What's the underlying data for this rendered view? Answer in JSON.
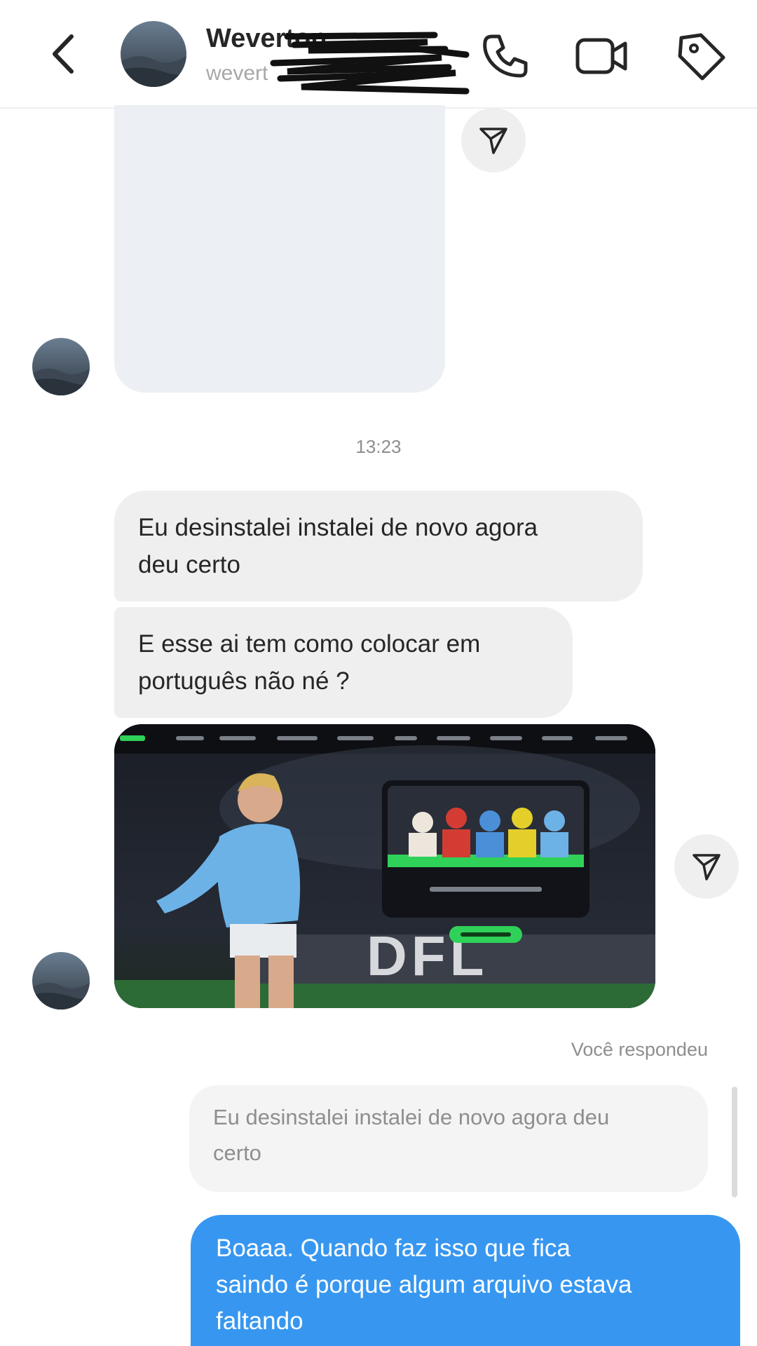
{
  "header": {
    "contact_name": "Weverton",
    "contact_username": "wevert",
    "icons": [
      "back-icon",
      "phone-icon",
      "video-call-icon",
      "tag-icon"
    ]
  },
  "messages": {
    "timestamp": "13:23",
    "incoming_1": {
      "line1": "Eu desinstalei instalei de novo agora",
      "line2": "deu certo"
    },
    "incoming_2": {
      "line1": "E esse ai tem como colocar em",
      "line2": "português não né ?"
    },
    "image_watermark": "DFL",
    "reply_label": "Você respondeu",
    "quoted": {
      "line1": "Eu desinstalei instalei de novo agora deu",
      "line2": "certo"
    },
    "outgoing": {
      "line1": "Boaaa. Quando faz isso que fica",
      "line2": "saindo é porque algum arquivo estava",
      "line3": "faltando"
    }
  },
  "colors": {
    "outgoing_bubble": "#3797f0",
    "incoming_bubble": "#efefef",
    "accent_green": "#2fd158"
  }
}
